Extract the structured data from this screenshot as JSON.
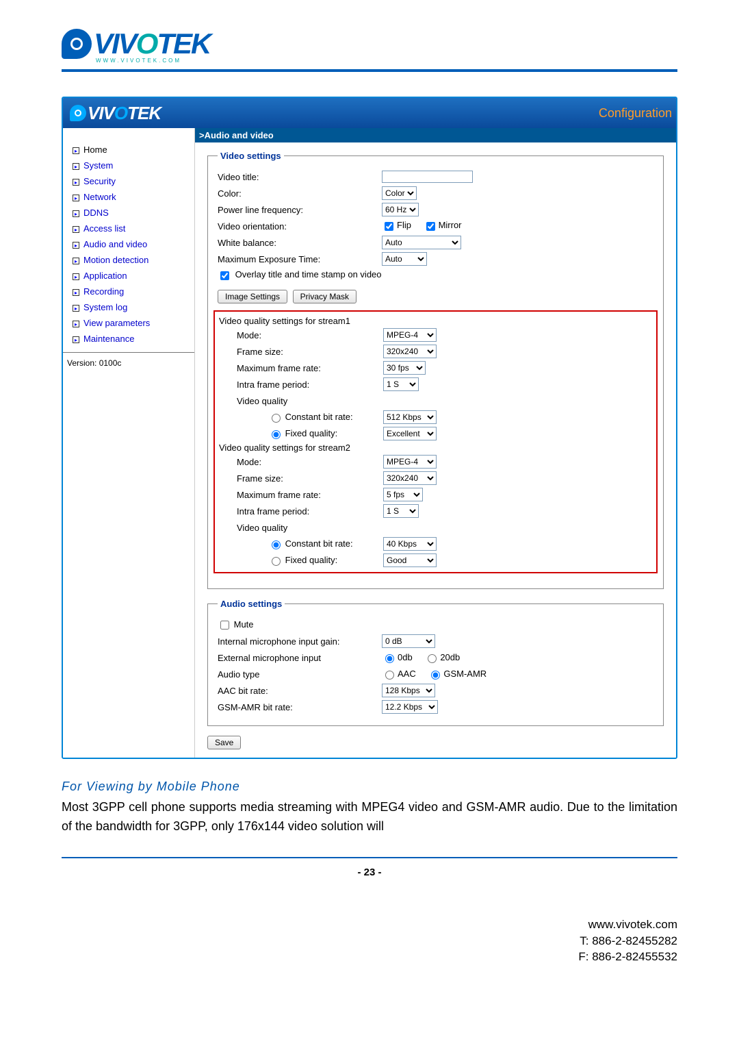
{
  "logo_sub": "WWW.VIVOTEK.COM",
  "header": {
    "config_label": "Configuration"
  },
  "sidebar": {
    "items": [
      {
        "label": "Home"
      },
      {
        "label": "System"
      },
      {
        "label": "Security"
      },
      {
        "label": "Network"
      },
      {
        "label": "DDNS"
      },
      {
        "label": "Access list"
      },
      {
        "label": "Audio and video"
      },
      {
        "label": "Motion detection"
      },
      {
        "label": "Application"
      },
      {
        "label": "Recording"
      },
      {
        "label": "System log"
      },
      {
        "label": "View parameters"
      },
      {
        "label": "Maintenance"
      }
    ],
    "version_label": "Version: 0100c"
  },
  "breadcrumb": ">Audio and video",
  "video_settings": {
    "legend": "Video settings",
    "video_title_label": "Video title:",
    "video_title_value": "",
    "color_label": "Color:",
    "color_value": "Color",
    "plf_label": "Power line frequency:",
    "plf_value": "60 Hz",
    "orientation_label": "Video orientation:",
    "flip_label": "Flip",
    "mirror_label": "Mirror",
    "wb_label": "White balance:",
    "wb_value": "Auto",
    "exposure_label": "Maximum Exposure Time:",
    "exposure_value": "Auto",
    "overlay_label": "Overlay title and time stamp on video",
    "image_settings_btn": "Image Settings",
    "privacy_mask_btn": "Privacy Mask"
  },
  "stream1": {
    "header": "Video quality settings for stream1",
    "mode_label": "Mode:",
    "mode_value": "MPEG-4",
    "frame_size_label": "Frame size:",
    "frame_size_value": "320x240",
    "max_fps_label": "Maximum frame rate:",
    "max_fps_value": "30 fps",
    "intra_label": "Intra frame period:",
    "intra_value": "1 S",
    "vq_label": "Video quality",
    "cbr_label": "Constant bit rate:",
    "cbr_value": "512 Kbps",
    "fq_label": "Fixed quality:",
    "fq_value": "Excellent"
  },
  "stream2": {
    "header": "Video quality settings for stream2",
    "mode_label": "Mode:",
    "mode_value": "MPEG-4",
    "frame_size_label": "Frame size:",
    "frame_size_value": "320x240",
    "max_fps_label": "Maximum frame rate:",
    "max_fps_value": "5 fps",
    "intra_label": "Intra frame period:",
    "intra_value": "1 S",
    "vq_label": "Video quality",
    "cbr_label": "Constant bit rate:",
    "cbr_value": "40 Kbps",
    "fq_label": "Fixed quality:",
    "fq_value": "Good"
  },
  "audio_settings": {
    "legend": "Audio settings",
    "mute_label": "Mute",
    "int_gain_label": "Internal microphone input gain:",
    "int_gain_value": "0 dB",
    "ext_input_label": "External microphone input",
    "ext_0db": "0db",
    "ext_20db": "20db",
    "audio_type_label": "Audio type",
    "aac_label": "AAC",
    "gsm_label": "GSM-AMR",
    "aac_br_label": "AAC bit rate:",
    "aac_br_value": "128 Kbps",
    "gsm_br_label": "GSM-AMR bit rate:",
    "gsm_br_value": "12.2 Kbps"
  },
  "save_btn": "Save",
  "mobile": {
    "heading": "For Viewing by Mobile Phone",
    "text": "Most 3GPP cell phone supports media streaming with MPEG4 video and GSM-AMR audio. Due to the limitation of the bandwidth for 3GPP, only 176x144 video solution will"
  },
  "page_number": "- 23 -",
  "footer": {
    "url": "www.vivotek.com",
    "tel": "T: 886-2-82455282",
    "fax": "F: 886-2-82455532"
  }
}
